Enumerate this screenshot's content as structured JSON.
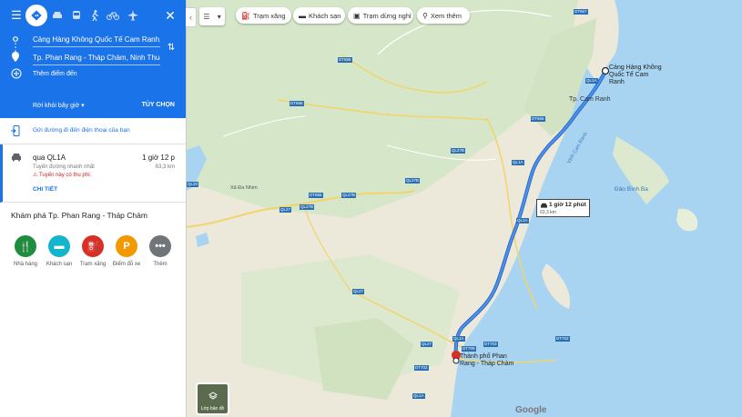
{
  "directions": {
    "origin": "Cảng Hàng Không Quốc Tế Cam Ranh, Cam Hải Đông, Cam Lâm, Khánh Hòa",
    "destination": "Tp. Phan Rang - Tháp Chàm, Ninh Thuận",
    "add_destination": "Thêm điểm đến",
    "leave_now": "Rời khỏi bây giờ",
    "options": "TÙY CHỌN",
    "send_to_phone": "Gửi đường đi đến điện thoại của bạn"
  },
  "route": {
    "via": "qua QL1A",
    "duration": "1 giờ 12 p",
    "subtitle": "Tuyến đường nhanh nhất",
    "distance": "63,3 km",
    "toll_note": "Tuyến này có thu phí.",
    "details": "CHI TIẾT"
  },
  "explore": {
    "title": "Khám phá Tp. Phan Rang - Tháp Chàm",
    "categories": [
      {
        "label": "Nhà hàng",
        "color": "#1e8e3e",
        "icon": "restaurant-icon"
      },
      {
        "label": "Khách sạn",
        "color": "#12b5cb",
        "icon": "hotel-icon"
      },
      {
        "label": "Trạm xăng",
        "color": "#d93025",
        "icon": "gas-station-icon"
      },
      {
        "label": "Điểm đỗ xe",
        "color": "#f29900",
        "icon": "parking-icon"
      },
      {
        "label": "Thêm",
        "color": "#70757a",
        "icon": "more-icon"
      }
    ]
  },
  "map_chips": [
    {
      "label": "Trạm xăng",
      "icon": "gas-station-icon"
    },
    {
      "label": "Khách sạn",
      "icon": "hotel-icon"
    },
    {
      "label": "Trạm dừng nghỉ",
      "icon": "rest-stop-icon"
    },
    {
      "label": "Xem thêm",
      "icon": "search-icon"
    }
  ],
  "map": {
    "layer_dropdown": "☰",
    "route_box": {
      "duration": "1 giờ 12 phút",
      "distance": "63,3 km"
    },
    "origin_label": "Cảng Hàng Không Quốc Tế Cam Ranh",
    "destination_label": "Thành phố Phan Rang - Tháp Chàm",
    "places": [
      {
        "name": "Tp. Cam Ranh"
      },
      {
        "name": "Vịnh Cam Ranh"
      },
      {
        "name": "Đảo Bình Ba"
      },
      {
        "name": "Xã Đa Nhim"
      }
    ],
    "roads": [
      "QL1A",
      "QL27",
      "QL27B",
      "DT656",
      "DT702",
      "DT703",
      "DT709",
      "DT657",
      "QL20"
    ],
    "layers_label": "Lớp bản đồ",
    "google": "Google"
  },
  "colors": {
    "primary": "#1a73e8",
    "route": "#1a73e8",
    "water": "#a8d4f2",
    "land": "#ece9da"
  }
}
